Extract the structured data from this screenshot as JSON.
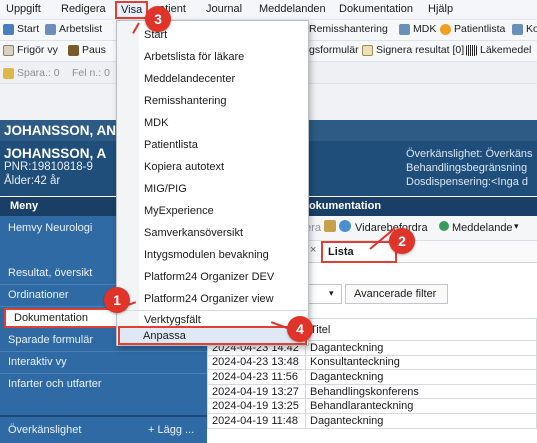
{
  "menubar": {
    "items": [
      "Uppgift",
      "Redigera",
      "Visa",
      "Patient",
      "Journal",
      "Meddelanden",
      "Dokumentation",
      "Hjälp"
    ],
    "active": "Visa",
    "patient_visible": "atient"
  },
  "toolbar1": {
    "start": "Start",
    "arbetslista": "Arbetslist",
    "remiss": "Remisshantering",
    "mdk": "MDK",
    "patientlista": "Patientlista",
    "ko": "Ko"
  },
  "toolbar2": {
    "frigor": "Frigör vy",
    "paus": "Paus",
    "formular": "gsformulär",
    "signera": "Signera resultat [0]",
    "lakemedel": "Läkemedel"
  },
  "toolbar3": {
    "spara": "Spara.: 0",
    "fel": "Fel n.: 0"
  },
  "patient": {
    "strip_name": "JOHANSSON, AN",
    "name": "JOHANSSON, A",
    "pnr": "PNR:19810818-9",
    "age": "Ålder:42 år",
    "overkanslighet": "Överkänslighet: Överkäns",
    "behandling": "Behandlingsbegränsning",
    "dos": "Dosdispensering:<Inga d"
  },
  "leftnav": {
    "title": "Meny",
    "items": [
      "Hemvy Neurologi",
      "Resultat, översikt",
      "Ordinationer",
      "Dokumentation",
      "Sparade formulär",
      "Interaktiv vy",
      "Infarter och utfarter"
    ],
    "overkanslighet": "Överkänslighet",
    "lagg": "+ Lägg ..."
  },
  "doc": {
    "title": "Dokumentation",
    "toolbar_a": "nera",
    "toolbar_b": "Vidarebefordra",
    "toolbar_c": "Meddelande",
    "tab_partial": "g",
    "tab_close": "×",
    "tab_lista": "Lista",
    "filter_button": "Avancerade filter"
  },
  "table": {
    "header_title": "Titel",
    "rows": [
      [
        "2024-04-23 14:42",
        "Daganteckning"
      ],
      [
        "2024-04-23 13:48",
        "Konsultanteckning"
      ],
      [
        "2024-04-23 11:56",
        "Daganteckning"
      ],
      [
        "2024-04-19 13:27",
        "Behandlingskonferens"
      ],
      [
        "2024-04-19 13:25",
        "Behandlaranteckning"
      ],
      [
        "2024-04-19 11:48",
        "Daganteckning"
      ]
    ]
  },
  "dropdown": {
    "items": [
      "Start",
      "Arbetslista för läkare",
      "Meddelandecenter",
      "Remisshantering",
      "MDK",
      "Patientlista",
      "Kopiera autotext",
      "MIG/PIG",
      "MyExperience",
      "Samverkansöversikt",
      "Intygsmodulen bevakning",
      "Platform24 Organizer DEV",
      "Platform24 Organizer view"
    ],
    "verktygsfalt": "Verktygsfält",
    "anpassa": "Anpassa"
  },
  "badges": [
    "1",
    "2",
    "3",
    "4"
  ],
  "colors": {
    "accent_red": "#e0342a",
    "nav_blue": "#2f6aa4",
    "header_blue": "#1f4e7a"
  }
}
